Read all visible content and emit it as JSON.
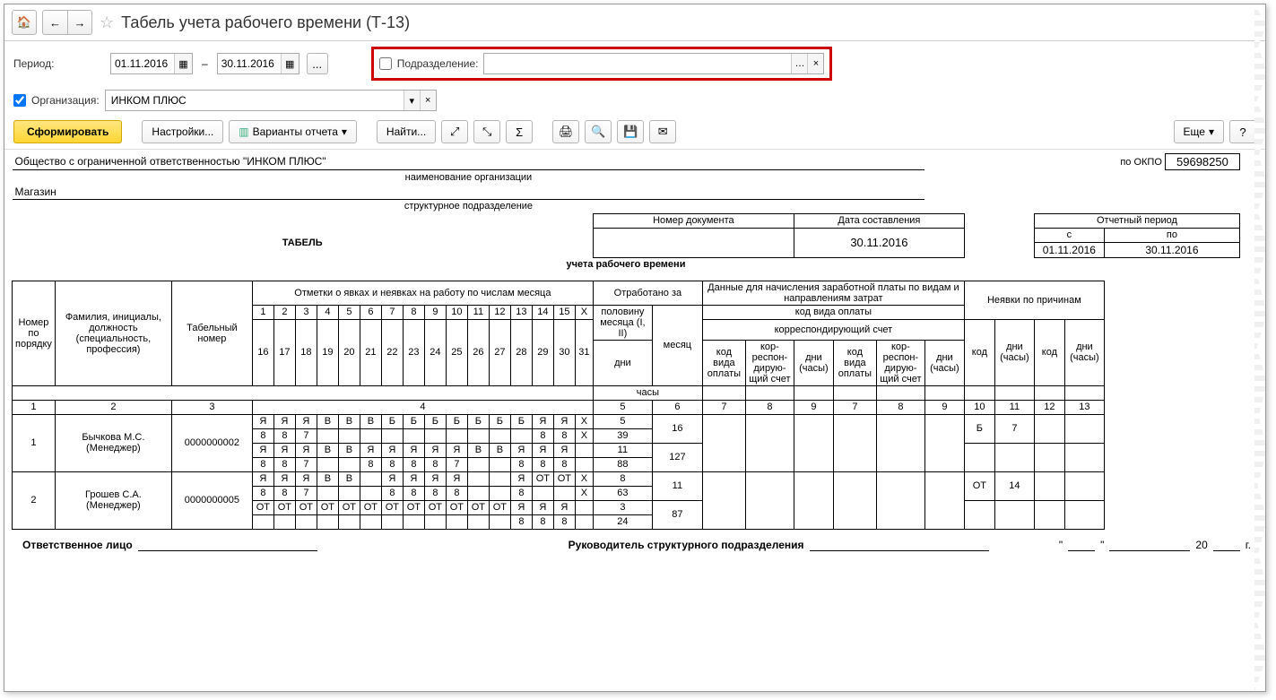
{
  "header": {
    "title": "Табель учета рабочего времени (Т-13)"
  },
  "filters": {
    "period_label": "Период:",
    "date_from": "01.11.2016",
    "date_to": "30.11.2016",
    "ellipsis": "...",
    "org_label": "Организация:",
    "org_value": "ИНКОМ ПЛЮС",
    "sub_label": "Подразделение:",
    "sub_value": ""
  },
  "toolbar": {
    "generate": "Сформировать",
    "settings": "Настройки...",
    "variants": "Варианты отчета",
    "find": "Найти...",
    "more": "Еще"
  },
  "report": {
    "org_full": "Общество с ограниченной ответственностью \"ИНКОМ ПЛЮС\"",
    "org_sub": "наименование организации",
    "dept": "Магазин",
    "dept_sub": "структурное подразделение",
    "okpo_label": "по ОКПО",
    "okpo": "59698250",
    "docnum_h": "Номер документа",
    "docdate_h": "Дата составления",
    "docnum": "",
    "docdate": "30.11.2016",
    "period_h": "Отчетный период",
    "from_h": "с",
    "to_h": "по",
    "period_from": "01.11.2016",
    "period_to": "30.11.2016",
    "title": "ТАБЕЛЬ",
    "subtitle": "учета  рабочего времени"
  },
  "cols": {
    "c1": "Номер по порядку",
    "c2": "Фамилия, инициалы, должность (специальность, профессия)",
    "c3": "Табельный номер",
    "c4": "Отметки о явках и неявках на работу по числам месяца",
    "c5": "Отработано за",
    "c5a": "половину месяца (I, II)",
    "c5b": "месяц",
    "c5c": "дни",
    "c5d": "часы",
    "c6": "Данные для начисления заработной платы по видам и направлениям затрат",
    "c6a": "код вида оплаты",
    "c6b": "корреспондирующий счет",
    "c6c": "код вида оплаты",
    "c6d": "кор-респон-дирую-щий счет",
    "c6e": "дни (часы)",
    "c7": "Неявки по причинам",
    "c7a": "код",
    "c7b": "дни (часы)",
    "n1": "1",
    "n2": "2",
    "n3": "3",
    "n4": "4",
    "n5": "5",
    "n6": "6",
    "n7": "7",
    "n8": "8",
    "n9": "9",
    "n10": "10",
    "n11": "11",
    "n12": "12",
    "n13": "13",
    "d1": "1",
    "d2": "2",
    "d3": "3",
    "d4": "4",
    "d5": "5",
    "d6": "6",
    "d7": "7",
    "d8": "8",
    "d9": "9",
    "d10": "10",
    "d11": "11",
    "d12": "12",
    "d13": "13",
    "d14": "14",
    "d15": "15",
    "dx": "Х",
    "d16": "16",
    "d17": "17",
    "d18": "18",
    "d19": "19",
    "d20": "20",
    "d21": "21",
    "d22": "22",
    "d23": "23",
    "d24": "24",
    "d25": "25",
    "d26": "26",
    "d27": "27",
    "d28": "28",
    "d29": "29",
    "d30": "30",
    "d31": "31"
  },
  "rows": [
    {
      "num": "1",
      "name": "Бычкова М.С.\n(Менеджер)",
      "tab": "0000000002",
      "line1": [
        "Я",
        "Я",
        "Я",
        "В",
        "В",
        "В",
        "Б",
        "Б",
        "Б",
        "Б",
        "Б",
        "Б",
        "Б",
        "Я",
        "Я",
        "Х"
      ],
      "line2": [
        "8",
        "8",
        "7",
        "",
        "",
        "",
        "",
        "",
        "",
        "",
        "",
        "",
        "",
        "8",
        "8",
        "Х"
      ],
      "line3": [
        "Я",
        "Я",
        "Я",
        "В",
        "В",
        "Я",
        "Я",
        "Я",
        "Я",
        "Я",
        "В",
        "В",
        "Я",
        "Я",
        "Я",
        ""
      ],
      "line4": [
        "8",
        "8",
        "7",
        "",
        "",
        "8",
        "8",
        "8",
        "8",
        "7",
        "",
        "",
        "8",
        "8",
        "8",
        ""
      ],
      "days1": "5",
      "hours1": "39",
      "days2": "11",
      "hours2": "88",
      "mdays": "16",
      "mhours": "127",
      "abs_code": "Б",
      "abs_days": "7"
    },
    {
      "num": "2",
      "name": "Грошев  С.А.\n(Менеджер)",
      "tab": "0000000005",
      "line1": [
        "Я",
        "Я",
        "Я",
        "В",
        "В",
        "",
        "Я",
        "Я",
        "Я",
        "Я",
        "",
        "",
        "Я",
        "ОТ",
        "ОТ",
        "Х"
      ],
      "line2": [
        "8",
        "8",
        "7",
        "",
        "",
        "",
        "8",
        "8",
        "8",
        "8",
        "",
        "",
        "8",
        "",
        "",
        "Х"
      ],
      "line3": [
        "ОТ",
        "ОТ",
        "ОТ",
        "ОТ",
        "ОТ",
        "ОТ",
        "ОТ",
        "ОТ",
        "ОТ",
        "ОТ",
        "ОТ",
        "ОТ",
        "Я",
        "Я",
        "Я",
        ""
      ],
      "line4": [
        "",
        "",
        "",
        "",
        "",
        "",
        "",
        "",
        "",
        "",
        "",
        "",
        "8",
        "8",
        "8",
        ""
      ],
      "days1": "8",
      "hours1": "63",
      "days2": "3",
      "hours2": "24",
      "mdays": "11",
      "mhours": "87",
      "abs_code": "ОТ",
      "abs_days": "14"
    }
  ],
  "footer": {
    "resp": "Ответственное лицо",
    "head": "Руководитель структурного подразделения",
    "date_tpl": "\"    \"              20    г."
  }
}
